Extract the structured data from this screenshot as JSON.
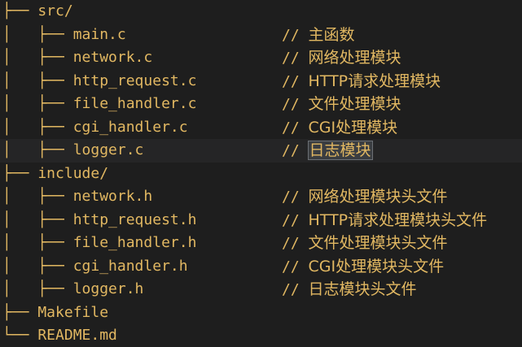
{
  "lines": [
    {
      "tree": "├── src/",
      "comment": ""
    },
    {
      "tree": "│   ├── main.c",
      "comment": "主函数"
    },
    {
      "tree": "│   ├── network.c",
      "comment": "网络处理模块"
    },
    {
      "tree": "│   ├── http_request.c",
      "comment": "HTTP请求处理模块"
    },
    {
      "tree": "│   ├── file_handler.c",
      "comment": "文件处理模块"
    },
    {
      "tree": "│   ├── cgi_handler.c",
      "comment": "CGI处理模块"
    },
    {
      "tree": "│   ├── logger.c",
      "comment": "日志模块",
      "selected": true
    },
    {
      "tree": "├── include/",
      "comment": ""
    },
    {
      "tree": "│   ├── network.h",
      "comment": "网络处理模块头文件"
    },
    {
      "tree": "│   ├── http_request.h",
      "comment": "HTTP请求处理模块头文件"
    },
    {
      "tree": "│   ├── file_handler.h",
      "comment": "文件处理模块头文件"
    },
    {
      "tree": "│   ├── cgi_handler.h",
      "comment": "CGI处理模块头文件"
    },
    {
      "tree": "│   ├── logger.h",
      "comment": "日志模块头文件"
    },
    {
      "tree": "├── Makefile",
      "comment": ""
    },
    {
      "tree": "└── README.md",
      "comment": ""
    }
  ],
  "comment_prefix": "// ",
  "colors": {
    "background": "#1e1e1e",
    "text": "#e2b862",
    "selection": "#3a3d41"
  }
}
